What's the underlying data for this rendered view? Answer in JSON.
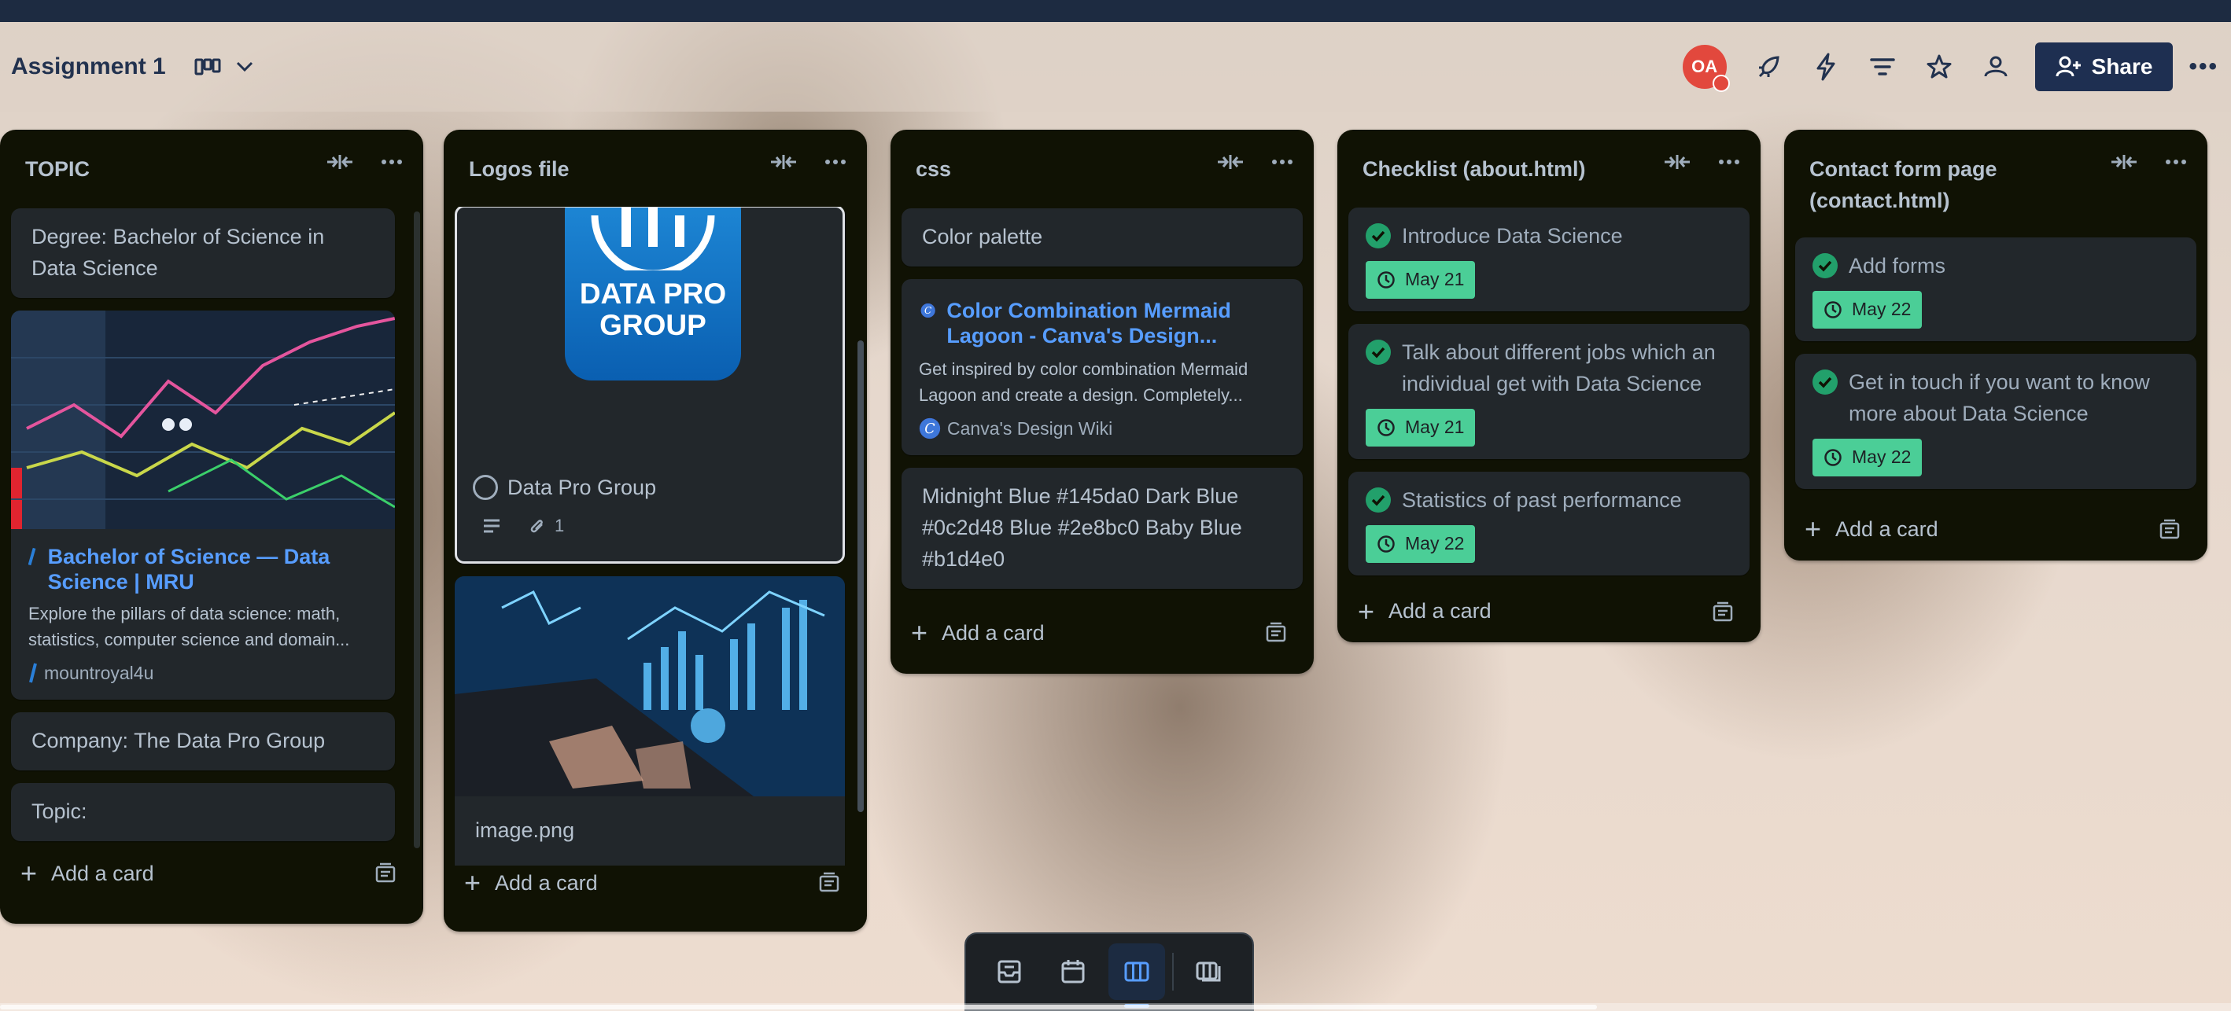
{
  "board": {
    "title": "Assignment 1",
    "avatar_initials": "OA",
    "share_label": "Share"
  },
  "lists": [
    {
      "title": "TOPIC",
      "cards": [
        {
          "text": "Degree: Bachelor of Science in Data Science"
        },
        {
          "link_title": "Bachelor of Science — Data Science | MRU",
          "link_desc": "Explore the pillars of data science: math, statistics, computer science and domain...",
          "link_source": "mountroyal4u"
        },
        {
          "text": "Company: The Data Pro Group"
        },
        {
          "text": "Topic:"
        }
      ],
      "add_label": "Add a card"
    },
    {
      "title": "Logos file",
      "cards": [
        {
          "logo_line1": "DATA PRO",
          "logo_line2": "GROUP",
          "text": "Data Pro Group",
          "attachments": "1"
        },
        {
          "text": "image.png"
        }
      ],
      "add_label": "Add a card"
    },
    {
      "title": "css",
      "cards": [
        {
          "text": "Color palette"
        },
        {
          "link_title": "Color Combination Mermaid Lagoon - Canva's Design...",
          "link_desc": "Get inspired by color combination Mermaid Lagoon and create a design. Completely...",
          "link_source": "Canva's Design Wiki"
        },
        {
          "text": "Midnight Blue #145da0 Dark Blue #0c2d48 Blue #2e8bc0 Baby Blue #b1d4e0"
        }
      ],
      "add_label": "Add a card"
    },
    {
      "title": "Checklist (about.html)",
      "cards": [
        {
          "text": "Introduce Data Science",
          "due": "May 21"
        },
        {
          "text": "Talk about different jobs which an individual get with Data Science",
          "due": "May 21"
        },
        {
          "text": "Statistics of past performance",
          "due": "May 22"
        }
      ],
      "add_label": "Add a card"
    },
    {
      "title": "Contact form page (contact.html)",
      "cards": [
        {
          "text": "Add forms",
          "due": "May 22"
        },
        {
          "text": "Get in touch if you want to know more about Data Science",
          "due": "May 22"
        }
      ],
      "add_label": "Add a card"
    }
  ],
  "colors": {
    "list_bg": "#101204",
    "card_bg": "#22272b",
    "link": "#579dff",
    "complete": "#4bce97",
    "share_bg": "#1e2f51"
  }
}
